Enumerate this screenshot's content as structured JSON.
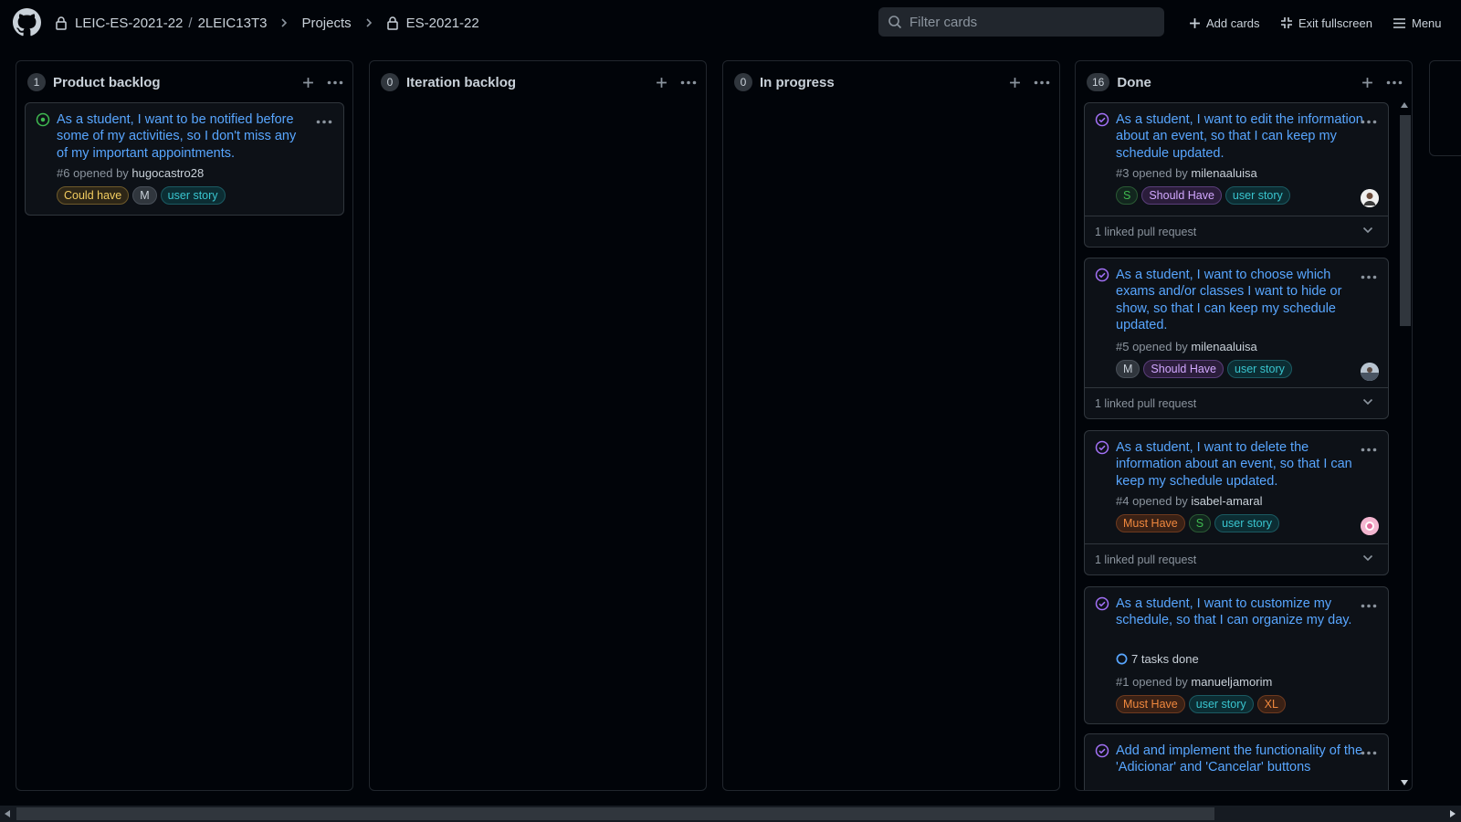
{
  "header": {
    "org": "LEIC-ES-2021-22",
    "repo": "2LEIC13T3",
    "projects": "Projects",
    "project": "ES-2021-22",
    "search_placeholder": "Filter cards",
    "add_cards": "Add cards",
    "exit_fullscreen": "Exit fullscreen",
    "menu": "Menu"
  },
  "columns": [
    {
      "title": "Product backlog",
      "count": "1"
    },
    {
      "title": "Iteration backlog",
      "count": "0"
    },
    {
      "title": "In progress",
      "count": "0"
    },
    {
      "title": "Done",
      "count": "16"
    }
  ],
  "backlog_card": {
    "title": "As a student, I want to be notified before some of my activities, so I don't miss any of my important appointments.",
    "number": "#6 opened by",
    "author": "hugocastro28",
    "labels": [
      "Could have",
      "M",
      "user story"
    ]
  },
  "done_cards": [
    {
      "title": "As a student, I want to edit the information about an event, so that I can keep my schedule updated.",
      "number": "#3 opened by",
      "author": "milenaaluisa",
      "labels": [
        "S",
        "Should Have",
        "user story"
      ],
      "linked": "1 linked pull request"
    },
    {
      "title": "As a student, I want to choose which exams and/or classes I want to hide or show, so that I can keep my schedule updated.",
      "number": "#5 opened by",
      "author": "milenaaluisa",
      "labels": [
        "M",
        "Should Have",
        "user story"
      ],
      "linked": "1 linked pull request"
    },
    {
      "title": "As a student, I want to delete the information about an event, so that I can keep my schedule updated.",
      "number": "#4 opened by",
      "author": "isabel-amaral",
      "labels": [
        "Must Have",
        "S",
        "user story"
      ],
      "linked": "1 linked pull request"
    },
    {
      "title": "As a student, I want to customize my schedule, so that I can organize my day.",
      "tasks": "7 tasks done",
      "number": "#1 opened by",
      "author": "manueljamorim",
      "labels": [
        "Must Have",
        "user story",
        "XL"
      ]
    },
    {
      "title": "Add and implement the functionality of the 'Adicionar' and 'Cancelar' buttons"
    }
  ],
  "colors": {
    "open_issue": "#3fb950",
    "closed_issue": "#a371f7",
    "link": "#58a6ff",
    "could_have": "#d29922",
    "should_have": "#d2a8ff",
    "must_have": "#f0883e",
    "user_story": "#39c5cf",
    "size_s": "#3fb950",
    "size_m": "#8b949e",
    "size_xl": "#f0883e"
  }
}
